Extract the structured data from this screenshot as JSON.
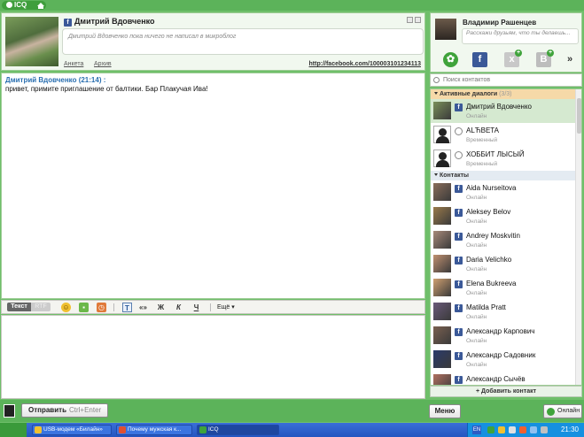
{
  "app": {
    "name": "ICQ"
  },
  "chat": {
    "contact_name": "Дмитрий Вдовченко",
    "microblog_placeholder": "Дмитрий Вдовченко пока ничего не написал в микроблог",
    "link_profile": "Анкета",
    "link_archive": "Архив",
    "facebook_url": "http://facebook.com/100003101234113",
    "messages": [
      {
        "author": "Дмитрий Вдовченко (21:14) :",
        "text": "привет, примите приглашение от балтики. Бар Плакучая Ива!"
      }
    ]
  },
  "toolbar": {
    "mode_text": "Текст",
    "mode_rtf": "RTF",
    "more_label": "Ещё",
    "tt_label": "T",
    "quote_label": "«»",
    "bold_label": "Ж",
    "italic_label": "К",
    "underline_label": "Ч"
  },
  "compose": {
    "send_label": "Отправить",
    "send_shortcut": "Ctrl+Enter"
  },
  "profile": {
    "name": "Владимир Рашенцев",
    "status_placeholder": "Расскажи друзьям, что ты делаешь...",
    "services": [
      "icq-icon",
      "facebook-icon",
      "x-service-icon",
      "vkontakte-icon"
    ]
  },
  "search": {
    "placeholder": "Поиск контактов"
  },
  "groups": {
    "active": {
      "title": "Активные диалоги",
      "count": "(3/3)"
    },
    "contacts": {
      "title": "Контакты"
    }
  },
  "active_dialogs": [
    {
      "name": "Дмитрий Вдовченко",
      "status": "Онлайн",
      "type": "facebook",
      "color": "#7a8f5a"
    },
    {
      "name": "ALЋBETA",
      "status": "Временный",
      "type": "gear",
      "color": "#ffffff"
    },
    {
      "name": "ХОББИТ ЛЫСЫЙ",
      "status": "Временный",
      "type": "gear",
      "color": "#ffffff"
    }
  ],
  "contacts": [
    {
      "name": "Aida Nurseitova",
      "status": "Онлайн",
      "color": "#8a6d5a"
    },
    {
      "name": "Aleksey Belov",
      "status": "Онлайн",
      "color": "#9a7a4a"
    },
    {
      "name": "Andrey Moskvitin",
      "status": "Онлайн",
      "color": "#a88a7a"
    },
    {
      "name": "Daria Velichko",
      "status": "Онлайн",
      "color": "#c09070"
    },
    {
      "name": "Elena Bukreeva",
      "status": "Онлайн",
      "color": "#d0a070"
    },
    {
      "name": "Matilda Pratt",
      "status": "Онлайн",
      "color": "#6a5a7a"
    },
    {
      "name": "Александр Карпович",
      "status": "Онлайн",
      "color": "#7a6050"
    },
    {
      "name": "Александр Садовник",
      "status": "Онлайн",
      "color": "#2a3a6a"
    },
    {
      "name": "Александр Сычёв",
      "status": "Онлайн",
      "color": "#b07060"
    }
  ],
  "add_contact_label": "+ Добавить контакт",
  "menu_label": "Меню",
  "online_label": "Онлайн",
  "taskbar": {
    "tasks": [
      {
        "label": "USB-модем «Билайн»",
        "color": "#f0c030"
      },
      {
        "label": "Почему мужская к...",
        "color": "#e05030"
      },
      {
        "label": "ICQ",
        "color": "#3fa33b"
      }
    ],
    "lang": "EN",
    "time": "21:30"
  }
}
